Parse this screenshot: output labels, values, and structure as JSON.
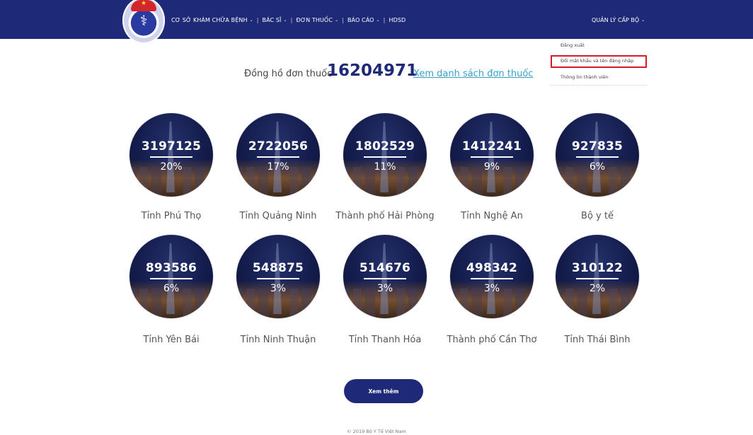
{
  "header": {
    "nav": [
      {
        "label": "CƠ SỞ KHÁM CHỮA BỆNH",
        "dropdown": true
      },
      {
        "label": "BÁC SĨ",
        "dropdown": true
      },
      {
        "label": "ĐƠN THUỐC",
        "dropdown": true
      },
      {
        "label": "BÁO CÁO",
        "dropdown": true
      },
      {
        "label": "HDSD",
        "dropdown": false
      }
    ],
    "separator": "|",
    "account_label": "QUẢN LÝ CẤP BỘ",
    "caret": "⌄"
  },
  "account_menu": {
    "items": [
      "Đăng xuất",
      "Đổi mật khẩu và tên đăng nhập",
      "Thông tin thành viên"
    ],
    "highlighted_index": 1,
    "highlight_color": "#d51c29"
  },
  "counter": {
    "prefix": "Đồng hồ đơn thuốc",
    "total": "16204971",
    "link": "Xem danh sách đơn thuốc"
  },
  "provinces": [
    {
      "count": "3197125",
      "percent": "20%",
      "name": "Tỉnh Phú Thọ"
    },
    {
      "count": "2722056",
      "percent": "17%",
      "name": "Tỉnh Quảng Ninh"
    },
    {
      "count": "1802529",
      "percent": "11%",
      "name": "Thành phố Hải Phòng"
    },
    {
      "count": "1412241",
      "percent": "9%",
      "name": "Tỉnh Nghệ An"
    },
    {
      "count": "927835",
      "percent": "6%",
      "name": "Bộ y tế"
    },
    {
      "count": "893586",
      "percent": "6%",
      "name": "Tỉnh Yên Bái"
    },
    {
      "count": "548875",
      "percent": "3%",
      "name": "Tỉnh Ninh Thuận"
    },
    {
      "count": "514676",
      "percent": "3%",
      "name": "Tỉnh Thanh Hóa"
    },
    {
      "count": "498342",
      "percent": "3%",
      "name": "Thành phố Cần Thơ"
    },
    {
      "count": "310122",
      "percent": "2%",
      "name": "Tỉnh Thái Bình"
    }
  ],
  "more_button": "Xem thêm",
  "footer": "© 2019 Bộ Y Tế Việt Nam",
  "colors": {
    "brand": "#1e2a78",
    "link": "#3aa0c6"
  }
}
